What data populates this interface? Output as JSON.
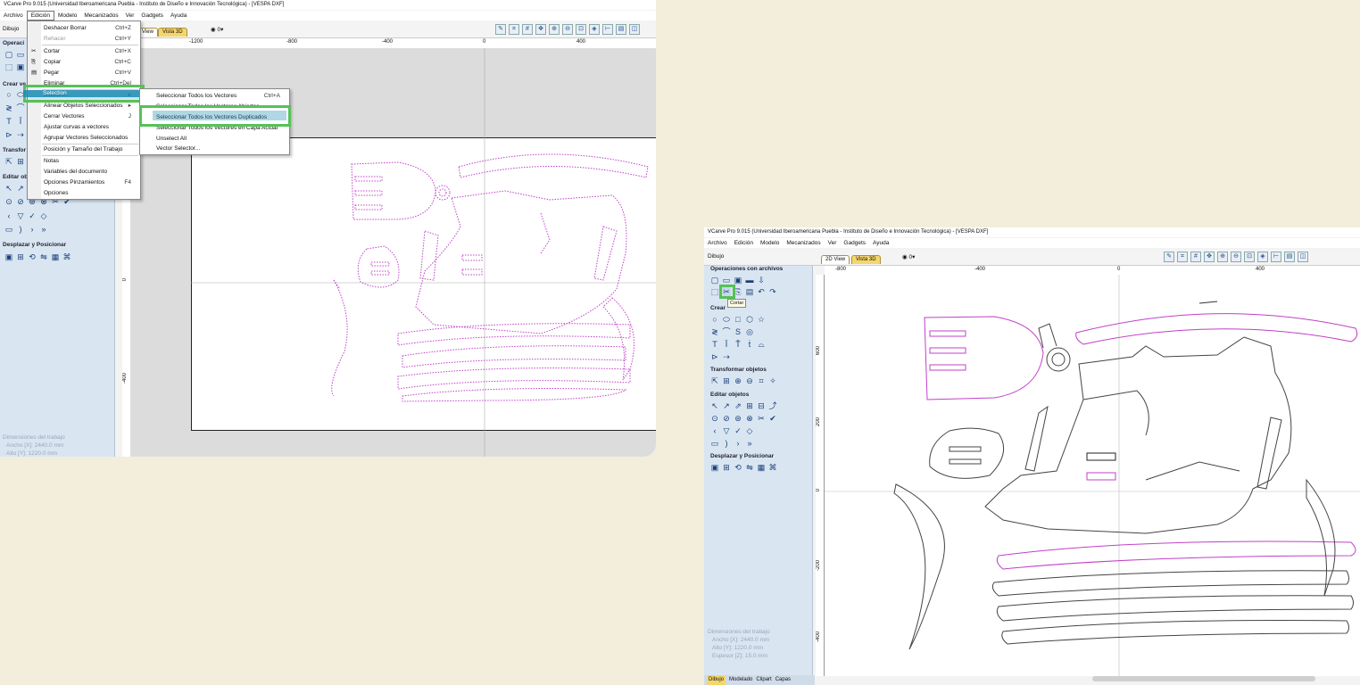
{
  "left_window": {
    "title": "VCarve Pro 9.015 (Universidad Iberoamericana Puebla - Instituto de Diseño e Innovación Tecnológica) - [VESPA DXF]",
    "menu": [
      "Archivo",
      "Edición",
      "Modelo",
      "Mecanizados",
      "Ver",
      "Gadgets",
      "Ayuda"
    ],
    "panel_label": "Dibujo",
    "tabs": [
      "View",
      "Vista 3D"
    ],
    "layer_value": "0",
    "ruler_h": [
      "-1200",
      "-800",
      "-400",
      "0",
      "400"
    ],
    "ruler_v": [
      "0",
      "-400"
    ],
    "sidebar_headers": [
      "Operaci",
      "Crear ve",
      "Transfor",
      "Editar ob",
      "Desplazar y Posicionar"
    ],
    "dims_lines": [
      "Dimensiones del trabajo",
      "Ancho   [X]: 2440.0 mm",
      "Alto   [Y]: 1220.0 mm"
    ],
    "edit_menu": [
      {
        "label": "Deshacer Borrar",
        "shortcut": "Ctrl+Z"
      },
      {
        "label": "Rehacer",
        "shortcut": "Ctrl+Y",
        "disabled": true
      },
      {
        "label": "Cortar",
        "shortcut": "Ctrl+X"
      },
      {
        "label": "Copiar",
        "shortcut": "Ctrl+C"
      },
      {
        "label": "Pegar",
        "shortcut": "Ctrl+V"
      },
      {
        "label": "Eliminar",
        "shortcut": "Ctrl+Del"
      },
      {
        "label": "Selection",
        "shortcut": "▸"
      },
      {
        "label": "Alinear Objetos Seleccionados",
        "shortcut": "▸"
      },
      {
        "label": "Cerrar Vectores",
        "shortcut": "J"
      },
      {
        "label": "Ajustar curvas a vectores",
        "shortcut": ""
      },
      {
        "label": "Agrupar Vectores Seleccionados",
        "shortcut": ""
      },
      {
        "label": "Posición y Tamaño del Trabajo",
        "shortcut": ""
      },
      {
        "label": "Notas",
        "shortcut": ""
      },
      {
        "label": "Variables del documento",
        "shortcut": ""
      },
      {
        "label": "Opciones Pinzamientos",
        "shortcut": "F4"
      },
      {
        "label": "Opciones",
        "shortcut": ""
      }
    ],
    "selection_submenu": [
      {
        "label": "Seleccionar Todos los Vectores",
        "shortcut": "Ctrl+A"
      },
      {
        "label": "Seleccionar Todos los Vectores Abiertos",
        "shortcut": ""
      },
      {
        "label": "Seleccionar Todos los Vectores Duplicados",
        "shortcut": ""
      },
      {
        "label": "Seleccionar Todos los Vectores en Capa Actual",
        "shortcut": ""
      },
      {
        "label": "Unselect All",
        "shortcut": ""
      },
      {
        "label": "Vector Selector...",
        "shortcut": ""
      }
    ]
  },
  "right_window": {
    "title": "VCarve Pro 9.015 (Universidad Iberoamericana Puebla - Instituto de Diseño e Innovación Tecnológica) - [VESPA DXF]",
    "menu": [
      "Archivo",
      "Edición",
      "Modelo",
      "Mecanizados",
      "Ver",
      "Gadgets",
      "Ayuda"
    ],
    "panel_label": "Dibujo",
    "tabs": [
      "2D View",
      "Vista 3D"
    ],
    "layer_value": "0",
    "ruler_h": [
      "-800",
      "-400",
      "0",
      "400"
    ],
    "ruler_v": [
      "600",
      "200",
      "0",
      "-200",
      "-400"
    ],
    "sidebar_headers": [
      "Operaciones con archivos",
      "Crear",
      "Transformar objetos",
      "Editar objetos",
      "Desplazar y Posicionar"
    ],
    "tooltip": "Cortar",
    "dims_lines": [
      "Dimensiones del trabajo",
      "Ancho   [X]: 2440.0 mm",
      "Alto   [Y]: 1220.0 mm",
      "Espesor [Z]: 15.0 mm"
    ],
    "bottom_tabs": [
      "Dibujo",
      "Modelado",
      "Clipart",
      "Capas"
    ]
  },
  "colors": {
    "highlight_green": "#57c157",
    "highlight_blue": "#1d8bb3",
    "vector_magenta": "#c040c8",
    "sidebar_bg": "#d9e6f2",
    "tab_yellow": "#f4d66b"
  }
}
